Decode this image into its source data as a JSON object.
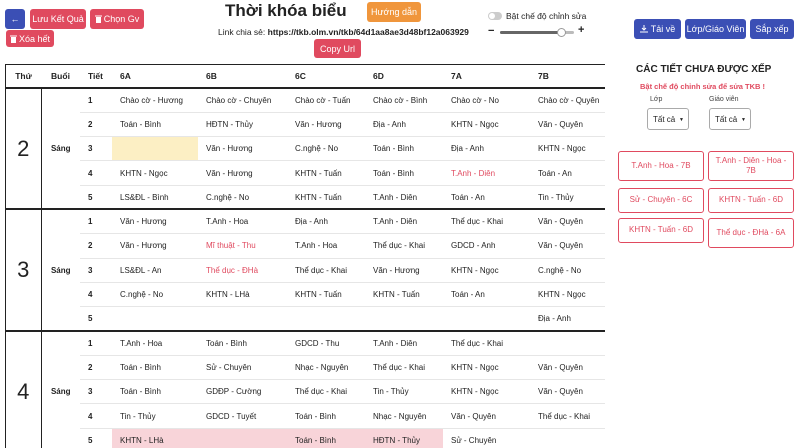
{
  "toolbar": {
    "back_glyph": "←",
    "save_label": "Lưu Kết Quả",
    "pick_teacher_label": "Chọn Gv",
    "clear_label": "Xóa hết",
    "guide_label": "Hướng dẫn",
    "copy_label": "Copy Url",
    "download_label": "Tải về",
    "class_teacher_label": "Lớp/Giáo Viên",
    "arrange_label": "Sắp xếp",
    "download_icon": "download-icon",
    "clear_icon": "trash-icon"
  },
  "page": {
    "title": "Thời khóa biểu",
    "share_prefix": "Link chia sẻ: ",
    "share_url": "https://tkb.olm.vn/tkb/64d1aa8ae3d48bf12a063929"
  },
  "edit_toggle": {
    "label": "Bật chế độ chỉnh sửa",
    "enabled": false
  },
  "zoom": {
    "minus": "−",
    "plus": "+",
    "level": 0.82
  },
  "grid": {
    "headers": [
      "Thứ",
      "Buổi",
      "Tiết",
      "6A",
      "6B",
      "6C",
      "6D",
      "7A",
      "7B"
    ],
    "days": [
      {
        "day": "2",
        "session": "Sáng",
        "rows": [
          {
            "period": "1",
            "cells": [
              "Chào cờ - Hương",
              "Chào cờ - Chuyên",
              "Chào cờ - Tuấn",
              "Chào cờ - Bình",
              "Chào cờ - No",
              "Chào cờ - Quyên"
            ]
          },
          {
            "period": "2",
            "cells": [
              "Toán - Bình",
              "HĐTN - Thủy",
              "Văn - Hương",
              "Địa - Anh",
              "KHTN - Ngọc",
              "Văn - Quyên"
            ]
          },
          {
            "period": "3",
            "cells": [
              "",
              "Văn - Hương",
              "C.nghệ - No",
              "Toán - Bình",
              "Địa - Anh",
              "KHTN - Ngọc"
            ]
          },
          {
            "period": "4",
            "cells": [
              "KHTN - Ngọc",
              "Văn - Hương",
              "KHTN - Tuấn",
              "Toán - Bình",
              "T.Anh - Diên",
              "Toán - An"
            ]
          },
          {
            "period": "5",
            "cells": [
              "LS&ĐL - Bình",
              "C.nghệ - No",
              "KHTN - Tuấn",
              "T.Anh - Diên",
              "Toán - An",
              "Tin - Thủy"
            ]
          }
        ]
      },
      {
        "day": "3",
        "session": "Sáng",
        "rows": [
          {
            "period": "1",
            "cells": [
              "Văn - Hương",
              "T.Anh - Hoa",
              "Địa - Anh",
              "T.Anh - Diên",
              "Thể dục - Khai",
              "Văn - Quyên"
            ]
          },
          {
            "period": "2",
            "cells": [
              "Văn - Hương",
              "Mĩ thuật - Thu",
              "T.Anh - Hoa",
              "Thể dục - Khai",
              "GDCD - Anh",
              "Văn - Quyên"
            ]
          },
          {
            "period": "3",
            "cells": [
              "LS&ĐL - An",
              "Thể dục - ĐHà",
              "Thể dục - Khai",
              "Văn - Hương",
              "KHTN - Ngọc",
              "C.nghệ - No"
            ]
          },
          {
            "period": "4",
            "cells": [
              "C.nghệ - No",
              "KHTN - LHà",
              "KHTN - Tuấn",
              "KHTN - Tuấn",
              "Toán - An",
              "KHTN - Ngọc"
            ]
          },
          {
            "period": "5",
            "cells": [
              "",
              "",
              "",
              "",
              "",
              "Địa - Anh"
            ]
          }
        ]
      },
      {
        "day": "4",
        "session": "Sáng",
        "rows": [
          {
            "period": "1",
            "cells": [
              "T.Anh - Hoa",
              "Toán - Bình",
              "GDCD - Thu",
              "T.Anh - Diên",
              "Thể dục - Khai",
              ""
            ]
          },
          {
            "period": "2",
            "cells": [
              "Toán - Bình",
              "Sử - Chuyên",
              "Nhạc - Nguyên",
              "Thể dục - Khai",
              "KHTN - Ngọc",
              "Văn - Quyên"
            ]
          },
          {
            "period": "3",
            "cells": [
              "Toán - Bình",
              "GDĐP - Cường",
              "Thể dục - Khai",
              "Tin - Thủy",
              "KHTN - Ngọc",
              "Văn - Quyên"
            ]
          },
          {
            "period": "4",
            "cells": [
              "Tin - Thủy",
              "GDCD - Tuyết",
              "Toán - Bình",
              "Nhạc - Nguyên",
              "Văn - Quyên",
              "Thể dục - Khai"
            ]
          },
          {
            "period": "5",
            "cells": [
              "KHTN - LHà",
              "",
              "Toán - Bình",
              "HĐTN - Thủy",
              "Sử - Chuyên",
              ""
            ]
          }
        ]
      }
    ]
  },
  "side": {
    "title": "CÁC TIẾT CHƯA ĐƯỢC XẾP",
    "warning": "Bật chế độ chỉnh sửa để sửa TKB !",
    "class_label": "Lớp",
    "teacher_label": "Giáo viên",
    "class_value": "Tất cả",
    "teacher_value": "Tất cả",
    "caret": "▼",
    "chips": [
      "T.Anh - Hoa - 7B",
      "T.Anh - Diên - Hoa - 7B",
      "Sử - Chuyên - 6C",
      "KHTN - Tuấn - 6D",
      "KHTN - Tuấn - 6D",
      "Thể dục - ĐHà - 6A"
    ]
  },
  "colors": {
    "accent_red": "#e04a5f",
    "accent_blue": "#3b4fb5",
    "accent_orange": "#f0963c",
    "empty_slot_yellow": "#fcefc4",
    "conflict_pink": "#f8d4d9"
  }
}
